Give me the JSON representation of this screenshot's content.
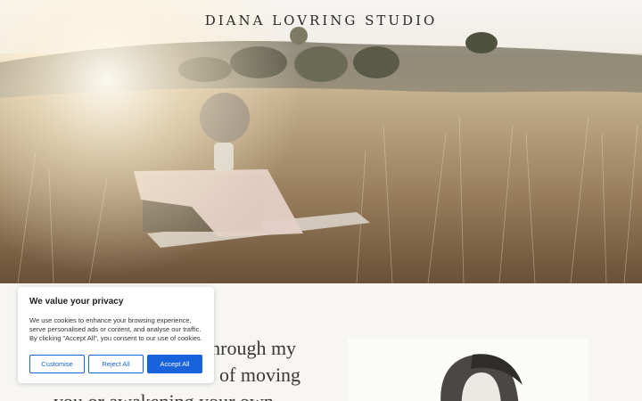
{
  "site": {
    "brand": "DIANA LOVRING STUDIO"
  },
  "intro": {
    "lines": [
      "through my",
      "of moving",
      "you or awakening your own"
    ]
  },
  "cookie_banner": {
    "title": "We value your privacy",
    "body": "We use cookies to enhance your browsing experience, serve personalised ads or content, and analyse our traffic. By clicking \"Accept All\", you consent to our use of cookies.",
    "buttons": {
      "customise": "Customise",
      "reject": "Reject All",
      "accept": "Accept All"
    },
    "accent_color": "#1863dc"
  }
}
